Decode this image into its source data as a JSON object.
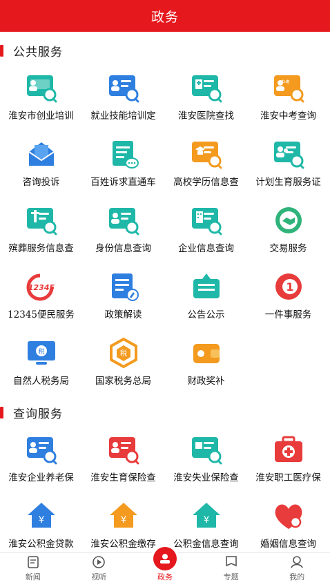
{
  "header": {
    "title": "政务"
  },
  "sections": [
    {
      "title": "公共服务"
    },
    {
      "title": "查询服务"
    }
  ],
  "public_services": [
    {
      "label": "淮安市创业培训",
      "icon": "training-card-icon"
    },
    {
      "label": "就业技能培训定",
      "icon": "skill-card-icon"
    },
    {
      "label": "淮安医院查找",
      "icon": "hospital-card-icon"
    },
    {
      "label": "淮安中考查询",
      "icon": "exam-card-icon"
    },
    {
      "label": "咨询投诉",
      "icon": "envelope-icon"
    },
    {
      "label": "百姓诉求直通车",
      "icon": "message-doc-icon"
    },
    {
      "label": "高校学历信息查",
      "icon": "diploma-card-icon"
    },
    {
      "label": "计划生育服务证",
      "icon": "family-card-icon"
    },
    {
      "label": "殡葬服务信息查",
      "icon": "funeral-card-icon"
    },
    {
      "label": "身份信息查询",
      "icon": "id-card-icon"
    },
    {
      "label": "企业信息查询",
      "icon": "building-card-icon"
    },
    {
      "label": "交易服务",
      "icon": "handshake-icon"
    },
    {
      "label": "12345便民服务",
      "icon": "hotline-12345-icon"
    },
    {
      "label": "政策解读",
      "icon": "policy-doc-icon"
    },
    {
      "label": "公告公示",
      "icon": "notice-board-icon"
    },
    {
      "label": "一件事服务",
      "icon": "one-service-icon"
    },
    {
      "label": "自然人税务局",
      "icon": "tax-monitor-icon"
    },
    {
      "label": "国家税务总局",
      "icon": "tax-hexagon-icon"
    },
    {
      "label": "财政奖补",
      "icon": "wallet-icon"
    }
  ],
  "query_services": [
    {
      "label": "淮安企业养老保",
      "icon": "pension-card-icon"
    },
    {
      "label": "淮安生育保险查",
      "icon": "maternity-card-icon"
    },
    {
      "label": "淮安失业保险查",
      "icon": "unemployment-card-icon"
    },
    {
      "label": "淮安职工医疗保",
      "icon": "medical-kit-icon"
    },
    {
      "label": "淮安公积金贷款",
      "icon": "fund-loan-house-icon"
    },
    {
      "label": "淮安公积金缴存",
      "icon": "fund-deposit-house-icon"
    },
    {
      "label": "公积金信息查询",
      "icon": "fund-info-house-icon"
    },
    {
      "label": "婚姻信息查询",
      "icon": "marriage-heart-icon"
    }
  ],
  "tabbar": [
    {
      "label": "新闻",
      "icon": "news-icon",
      "active": false
    },
    {
      "label": "视听",
      "icon": "play-icon",
      "active": false
    },
    {
      "label": "政务",
      "icon": "government-icon",
      "active": true
    },
    {
      "label": "专题",
      "icon": "topic-icon",
      "active": false
    },
    {
      "label": "我的",
      "icon": "profile-icon",
      "active": false
    }
  ],
  "colors": {
    "brand_red": "#e5181d",
    "icon_blue": "#2f7fe0",
    "icon_teal": "#1fb8a8",
    "icon_orange": "#f39a1f",
    "icon_red": "#e83b3b",
    "icon_green": "#2fb37a"
  }
}
